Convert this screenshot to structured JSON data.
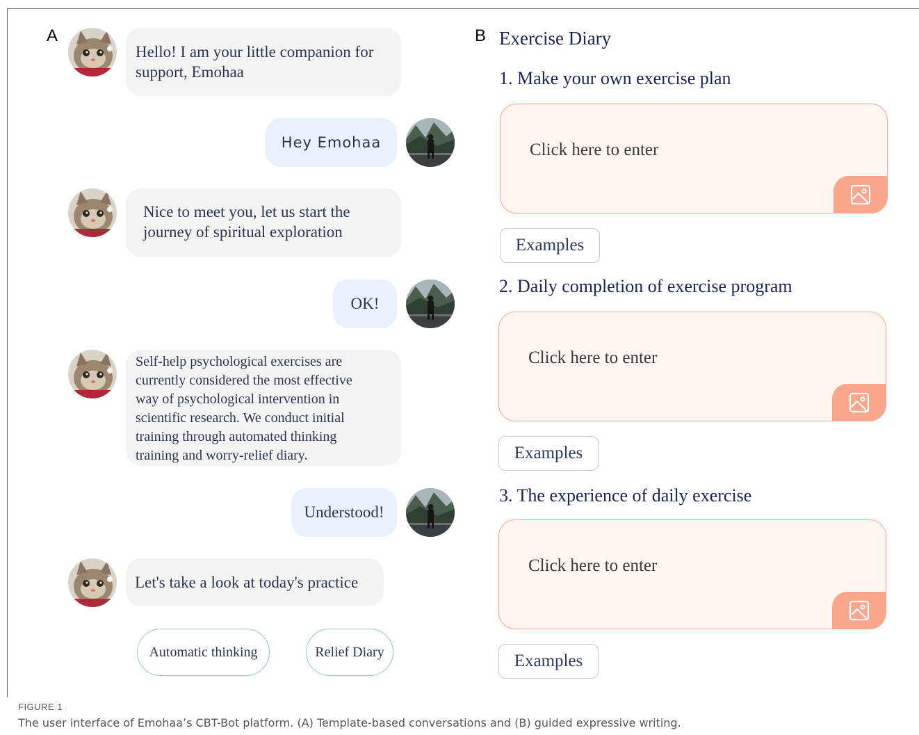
{
  "panel_a": {
    "letter": "A",
    "messages": [
      {
        "role": "bot",
        "text": "Hello! I am your little companion for support, Emohaa"
      },
      {
        "role": "user",
        "text": "Hey Emohaa"
      },
      {
        "role": "bot",
        "lines": [
          "Nice to meet you, let us start the",
          "journey of spiritual exploration"
        ]
      },
      {
        "role": "user",
        "text": "OK!"
      },
      {
        "role": "bot",
        "lines": [
          "Self-help psychological exercises are",
          "currently considered the most effective",
          "way of psychological intervention in",
          "scientific research. We conduct initial",
          "training through automated thinking",
          "training and worry-relief diary."
        ]
      },
      {
        "role": "user",
        "text": "Understood!"
      },
      {
        "role": "bot",
        "text": "Let's take a look at today's practice"
      }
    ],
    "msg1_lines": [
      "Hello! I am your little companion for",
      "support, Emohaa"
    ],
    "choices": [
      "Automatic thinking",
      "Relief Diary"
    ],
    "bot_avatar": "cat-avatar-icon",
    "user_avatar": "person-landscape-avatar-icon"
  },
  "panel_b": {
    "letter": "B",
    "title": "Exercise Diary",
    "sections": [
      {
        "heading": "1. Make your own exercise plan",
        "placeholder": "Click here to enter",
        "examples_label": "Examples"
      },
      {
        "heading": "2. Daily completion of exercise program",
        "placeholder": "Click here to enter",
        "examples_label": "Examples"
      },
      {
        "heading": "3. The experience of daily exercise",
        "placeholder": "Click here to enter",
        "examples_label": "Examples"
      }
    ],
    "image_icon": "image-upload-icon"
  },
  "caption": {
    "label": "FIGURE 1",
    "text": "The user interface of Emohaa’s CBT-Bot platform. (A) Template-based conversations and (B) guided expressive writing."
  },
  "colors": {
    "bot_bubble": "#f3f3f3",
    "user_bubble": "#e9f1fd",
    "entry_border": "#f2a98f",
    "entry_fill": "#fff6f2",
    "image_button": "#f8a68c",
    "choice_border": "#8fc5e4"
  }
}
